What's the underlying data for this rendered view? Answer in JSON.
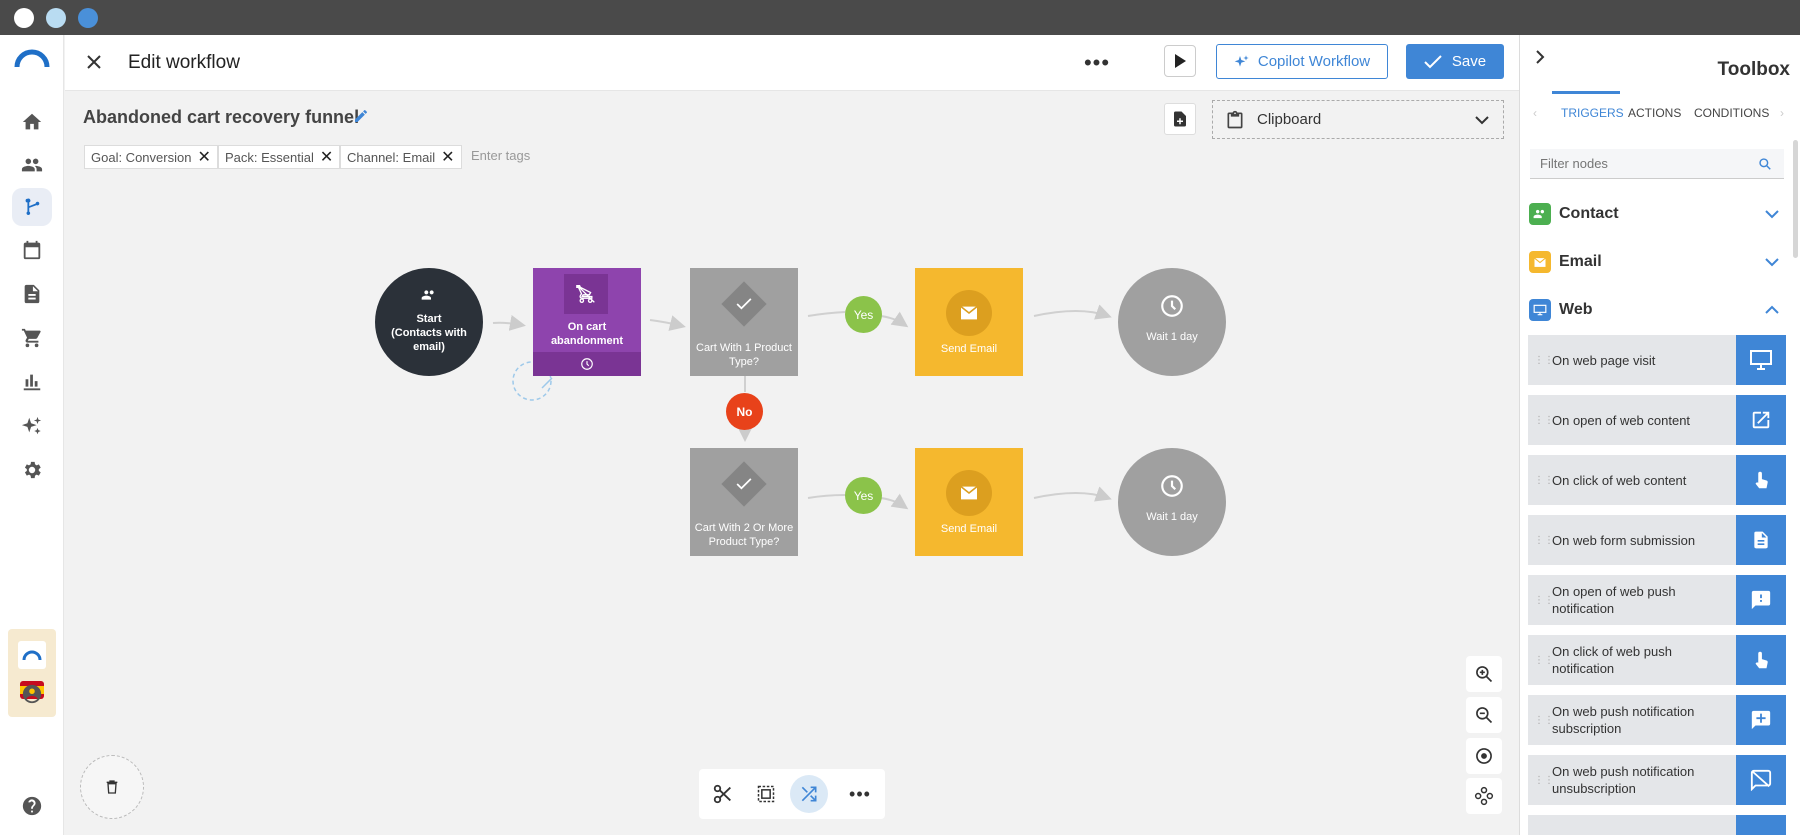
{
  "window": {
    "dots": [
      "#ffffff",
      "#b9dcf2",
      "#4a90d9"
    ]
  },
  "nav": {
    "items": [
      {
        "name": "home-icon",
        "active": false
      },
      {
        "name": "contacts-icon",
        "active": false
      },
      {
        "name": "workflow-icon",
        "active": true
      },
      {
        "name": "calendar-icon",
        "active": false
      },
      {
        "name": "document-icon",
        "active": false
      },
      {
        "name": "cart-icon",
        "active": false
      },
      {
        "name": "chart-icon",
        "active": false
      },
      {
        "name": "sparkle-icon",
        "active": false
      },
      {
        "name": "gear-icon",
        "active": false
      }
    ]
  },
  "header": {
    "title": "Edit workflow",
    "copilot_label": "Copilot Workflow",
    "save_label": "Save"
  },
  "workflow": {
    "name": "Abandoned cart recovery funnel",
    "tags": [
      {
        "label": "Goal: Conversion"
      },
      {
        "label": "Pack: Essential"
      },
      {
        "label": "Channel: Email"
      }
    ],
    "tags_placeholder": "Enter tags",
    "clipboard_label": "Clipboard"
  },
  "nodes": {
    "start": "Start\n(Contacts with\nemail)",
    "trigger": "On cart abandonment",
    "cond1": "Cart With 1 Product\nType?",
    "cond2": "Cart With 2 Or More\nProduct Type?",
    "email1": "Send Email",
    "email2": "Send Email",
    "wait1": "Wait 1 day",
    "wait2": "Wait 1 day",
    "yes1": "Yes",
    "yes2": "Yes",
    "no": "No"
  },
  "toolbox": {
    "title": "Toolbox",
    "tabs": [
      "TRIGGERS",
      "ACTIONS",
      "CONDITIONS"
    ],
    "active_tab": "TRIGGERS",
    "filter_placeholder": "Filter nodes",
    "categories": [
      {
        "label": "Contact",
        "color": "#4caf50",
        "expanded": false
      },
      {
        "label": "Email",
        "color": "#f5b82e",
        "expanded": false
      },
      {
        "label": "Web",
        "color": "#3f86d6",
        "expanded": true
      }
    ],
    "web_items": [
      "On web page visit",
      "On open of web content",
      "On click of web content",
      "On web form submission",
      "On open of web push notification",
      "On click of web push notification",
      "On web push notification subscription",
      "On web push notification unsubscription"
    ]
  },
  "colors": {
    "accent": "#3f86d6",
    "trigger_purple": "#8e44ad",
    "email_yellow": "#f5b82e",
    "condition_gray": "#9e9e9e",
    "no_red": "#e8421a",
    "yes_green": "#8bc34a"
  }
}
